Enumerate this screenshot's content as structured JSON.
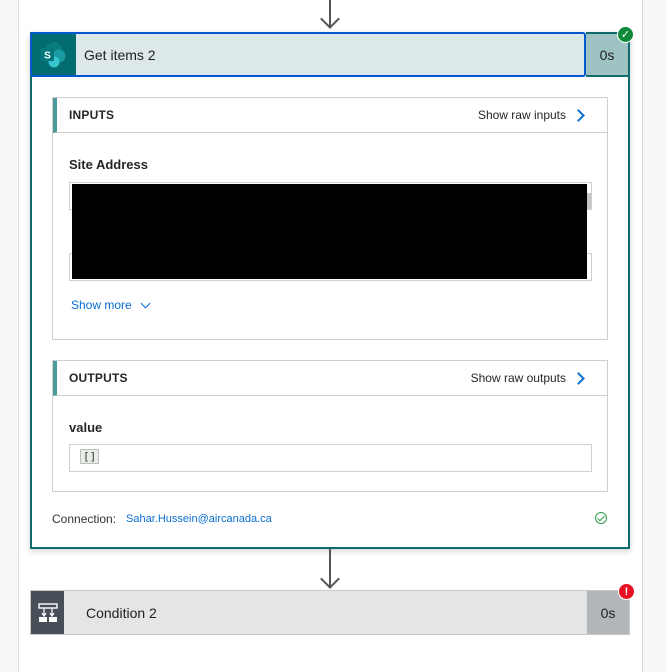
{
  "actions": [
    {
      "title": "Get items 2",
      "duration": "0s",
      "status": "succeeded",
      "icon": "sharepoint-icon",
      "icon_letter": "S",
      "inputs": {
        "section_title": "INPUTS",
        "raw_link": "Show raw inputs",
        "fields": [
          {
            "label": "Site Address",
            "value": ""
          }
        ],
        "show_more": "Show more"
      },
      "outputs": {
        "section_title": "OUTPUTS",
        "raw_link": "Show raw outputs",
        "fields": [
          {
            "label": "value",
            "value": "[]"
          }
        ]
      },
      "connection": {
        "label": "Connection:",
        "account": "Sahar.Hussein@aircanada.ca",
        "status_icon": "check-circle-icon"
      }
    },
    {
      "title": "Condition 2",
      "duration": "0s",
      "status": "failed",
      "icon": "condition-icon"
    }
  ],
  "colors": {
    "success": "#0e8a3a",
    "error": "#e81123",
    "sharepoint_teal": "#036c70",
    "link_blue": "#0a6ed1",
    "selection_blue": "#0058d1"
  }
}
